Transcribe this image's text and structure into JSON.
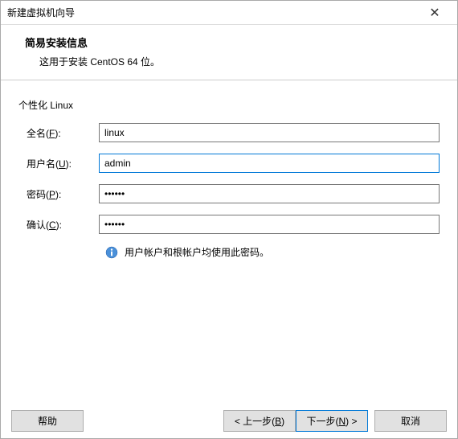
{
  "titlebar": {
    "title": "新建虚拟机向导"
  },
  "header": {
    "title": "简易安装信息",
    "subtitle": "这用于安装 CentOS 64 位。"
  },
  "section": {
    "label": "个性化 Linux"
  },
  "form": {
    "fullname": {
      "label_prefix": "全名(",
      "label_key": "F",
      "label_suffix": "):",
      "value": "linux"
    },
    "username": {
      "label_prefix": "用户名(",
      "label_key": "U",
      "label_suffix": "):",
      "value": "admin"
    },
    "password": {
      "label_prefix": "密码(",
      "label_key": "P",
      "label_suffix": "):",
      "value": "••••••"
    },
    "confirm": {
      "label_prefix": "确认(",
      "label_key": "C",
      "label_suffix": "):",
      "value": "••••••"
    }
  },
  "info": {
    "text": "用户帐户和根帐户均使用此密码。"
  },
  "buttons": {
    "help": "帮助",
    "back_prefix": "< 上一步(",
    "back_key": "B",
    "back_suffix": ")",
    "next_prefix": "下一步(",
    "next_key": "N",
    "next_suffix": ") >",
    "cancel": "取消"
  }
}
